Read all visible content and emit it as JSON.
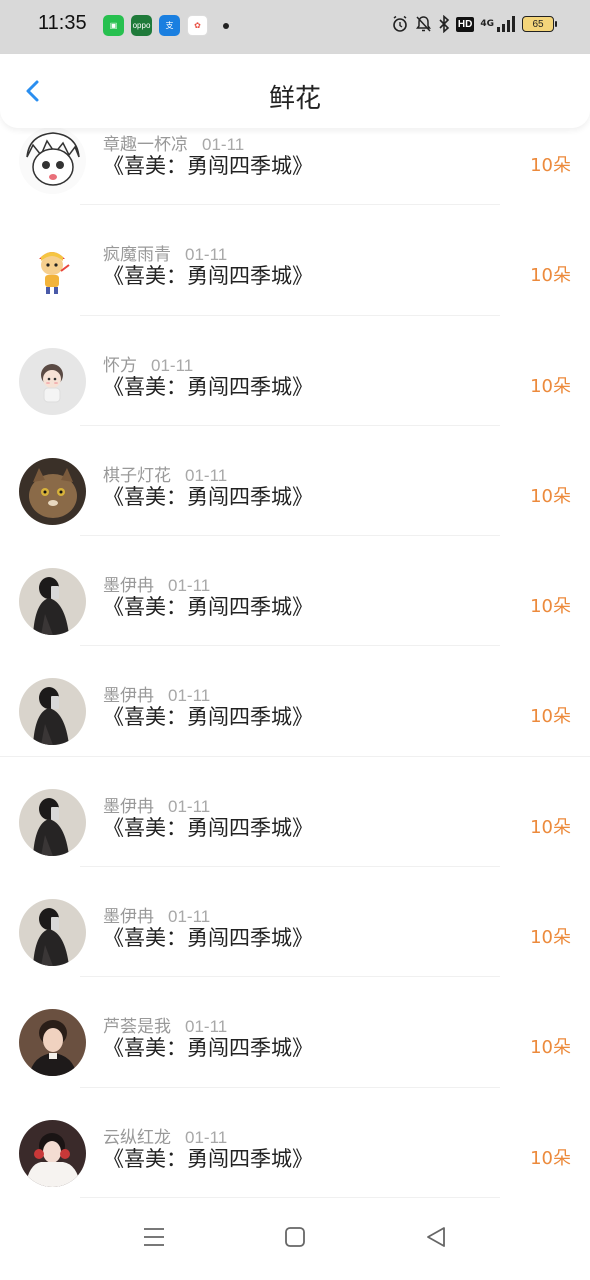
{
  "status_bar": {
    "time": "11:35",
    "app_icons": [
      {
        "icon": "wechat-style-app-icon",
        "color": "#27c04f"
      },
      {
        "icon": "oppo-app-icon",
        "color": "#1f7a3a"
      },
      {
        "icon": "alipay-style-app-icon",
        "color": "#1a7fe0"
      },
      {
        "icon": "baidu-style-app-icon",
        "color": "#e84a3d"
      }
    ],
    "network": "4G",
    "hd_label": "HD",
    "battery": "65"
  },
  "header": {
    "title": "鲜花"
  },
  "gifts": [
    {
      "name": "章趣一杯凉",
      "date": "01-11",
      "book": "《喜美：勇闯四季城》",
      "count": "10朵",
      "avatar": "anime-girl"
    },
    {
      "name": "疯魔雨青",
      "date": "01-11",
      "book": "《喜美：勇闯四季城》",
      "count": "10朵",
      "avatar": "cartoon-kid"
    },
    {
      "name": "怀方",
      "date": "01-11",
      "book": "《喜美：勇闯四季城》",
      "count": "10朵",
      "avatar": "chibi"
    },
    {
      "name": "棋子灯花",
      "date": "01-11",
      "book": "《喜美：勇闯四季城》",
      "count": "10朵",
      "avatar": "cat"
    },
    {
      "name": "墨伊冉",
      "date": "01-11",
      "book": "《喜美：勇闯四季城》",
      "count": "10朵",
      "avatar": "mirror-selfie"
    },
    {
      "name": "墨伊冉",
      "date": "01-11",
      "book": "《喜美：勇闯四季城》",
      "count": "10朵",
      "avatar": "mirror-selfie"
    },
    {
      "name": "墨伊冉",
      "date": "01-11",
      "book": "《喜美：勇闯四季城》",
      "count": "10朵",
      "avatar": "mirror-selfie"
    },
    {
      "name": "墨伊冉",
      "date": "01-11",
      "book": "《喜美：勇闯四季城》",
      "count": "10朵",
      "avatar": "mirror-selfie"
    },
    {
      "name": "芦荟是我",
      "date": "01-11",
      "book": "《喜美：勇闯四季城》",
      "count": "10朵",
      "avatar": "portrait-dark"
    },
    {
      "name": "云纵红龙",
      "date": "01-11",
      "book": "《喜美：勇闯四季城》",
      "count": "10朵",
      "avatar": "portrait-white"
    }
  ],
  "colors": {
    "accent_count": "#ec8a3c",
    "back_arrow": "#2a8ef0",
    "status_bar_bg": "#d9d9d9"
  }
}
